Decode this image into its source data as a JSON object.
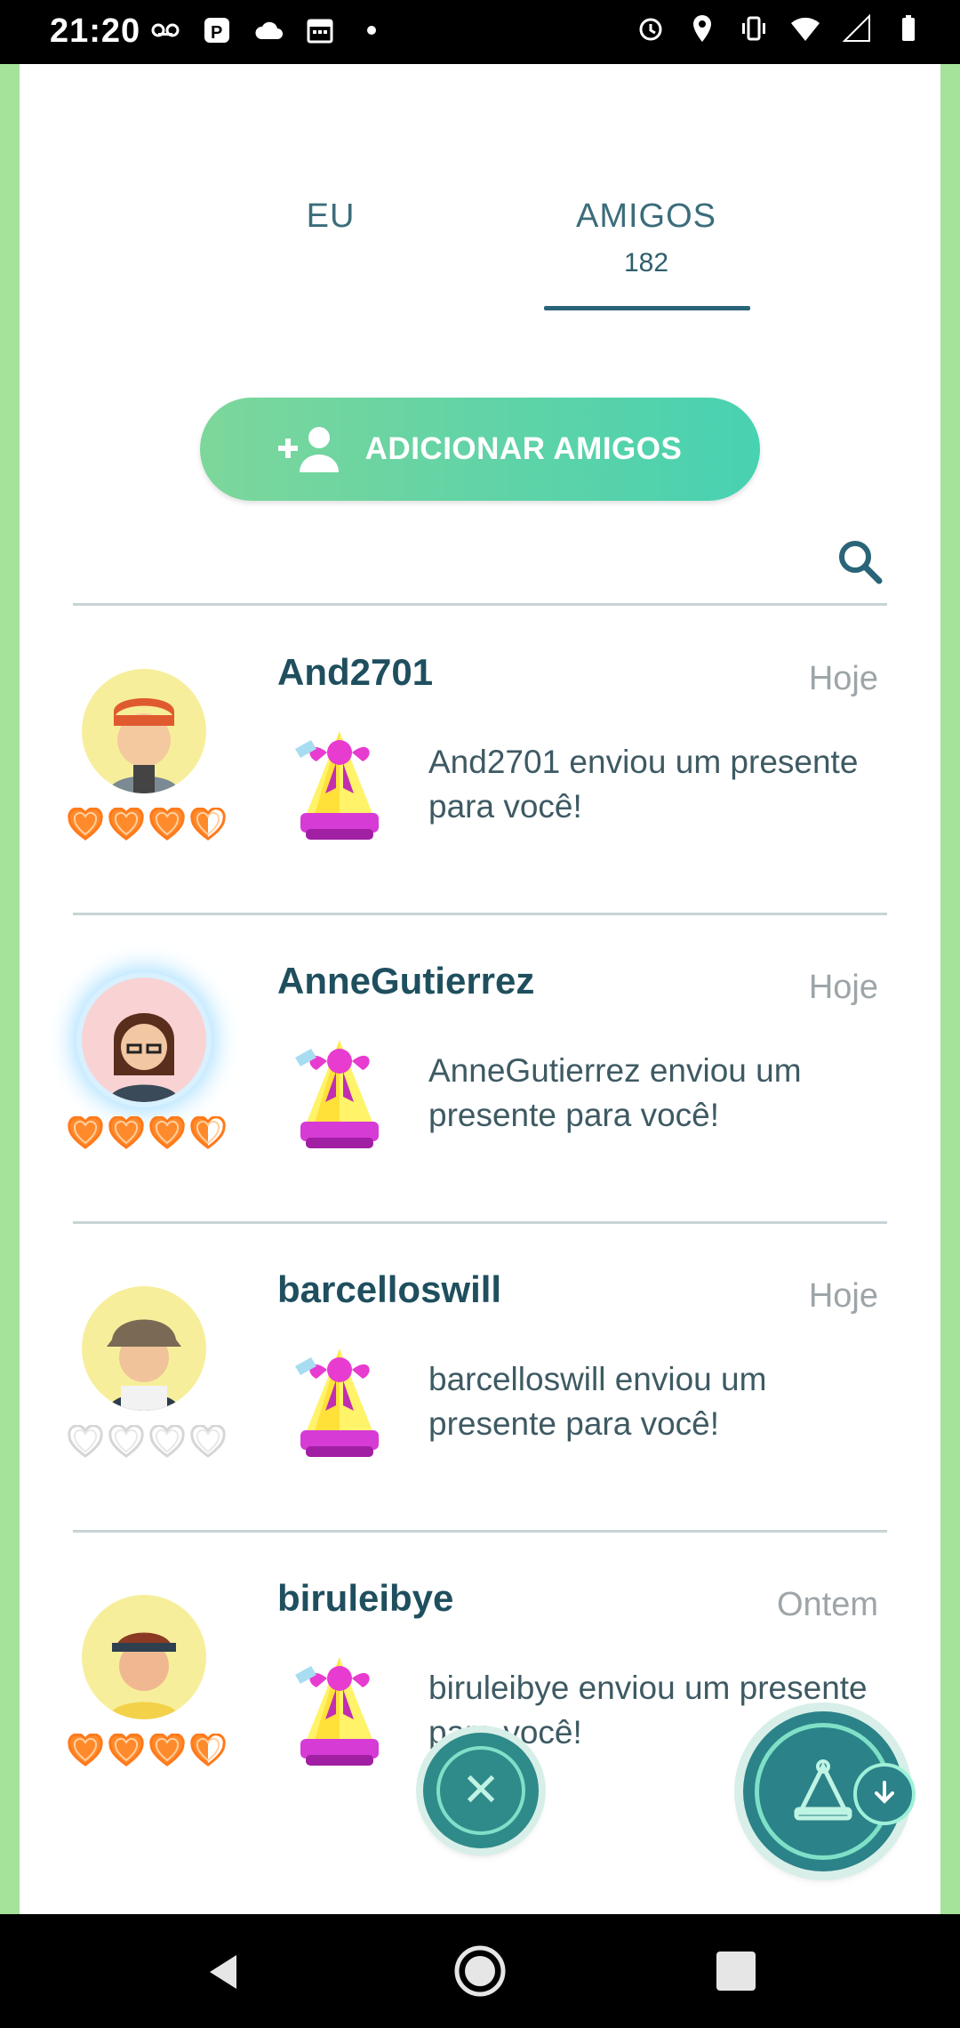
{
  "status_bar": {
    "time": "21:20"
  },
  "tabs": {
    "me_label": "EU",
    "friends_label": "AMIGOS",
    "friends_count": "182"
  },
  "add_friends_label": "ADICIONAR AMIGOS",
  "friends": [
    {
      "name": "And2701",
      "when": "Hoje",
      "message": "And2701 enviou um presente para você!",
      "hearts": 3.5
    },
    {
      "name": "AnneGutierrez",
      "when": "Hoje",
      "message": "AnneGutierrez enviou um presente para você!",
      "hearts": 3.5
    },
    {
      "name": "barcelloswill",
      "when": "Hoje",
      "message": "barcelloswill enviou um presente para você!",
      "hearts": 0
    },
    {
      "name": "biruleibye",
      "when": "Ontem",
      "message": "biruleibye enviou um presente para você!",
      "hearts": 3.5
    }
  ],
  "colors": {
    "accent": "#2a6478",
    "heart_filled": "#ff8a2b",
    "heart_empty": "#d6d6d6"
  }
}
